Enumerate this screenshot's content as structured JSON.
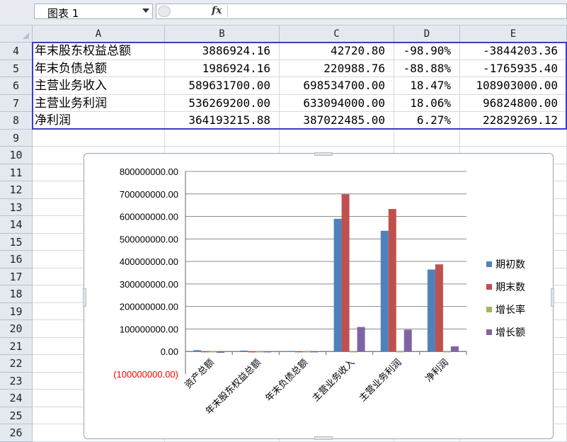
{
  "formula_bar": {
    "name_box": "图表 1",
    "fx_label": "fx",
    "formula": ""
  },
  "columns": [
    "A",
    "B",
    "C",
    "D",
    "E"
  ],
  "row_numbers": [
    "4",
    "5",
    "6",
    "7",
    "8",
    "9",
    "10",
    "11",
    "12",
    "13",
    "14",
    "15",
    "16",
    "17",
    "18",
    "19",
    "20",
    "21",
    "22",
    "23",
    "24",
    "25",
    "26"
  ],
  "rows": [
    [
      "年末股东权益总额",
      "3886924.16",
      "42720.80",
      "-98.90%",
      "-3844203.36"
    ],
    [
      "年末负债总额",
      "1986924.16",
      "220988.76",
      "-88.88%",
      "-1765935.40"
    ],
    [
      "主营业务收入",
      "589631700.00",
      "698534700.00",
      "18.47%",
      "108903000.00"
    ],
    [
      "主营业务利润",
      "536269200.00",
      "633094000.00",
      "18.06%",
      "96824800.00"
    ],
    [
      "净利润",
      "364193215.88",
      "387022485.00",
      "6.27%",
      "22829269.12"
    ]
  ],
  "chart_data": {
    "type": "bar",
    "title": "",
    "categories": [
      "资产总额",
      "年末股东权益总额",
      "年末负债总额",
      "主营业务收入",
      "主营业务利润",
      "净利润"
    ],
    "series": [
      {
        "name": "期初数",
        "color": "#4f81bd",
        "values": [
          5873848.32,
          3886924.16,
          1986924.16,
          589631700.0,
          536269200.0,
          364193215.88
        ]
      },
      {
        "name": "期末数",
        "color": "#c0504d",
        "values": [
          263709.56,
          42720.8,
          220988.76,
          698534700.0,
          633094000.0,
          387022485.0
        ]
      },
      {
        "name": "增长率",
        "color": "#9bbb59",
        "values": [
          -0.96,
          -0.989,
          -0.8888,
          0.1847,
          0.1806,
          0.0627
        ]
      },
      {
        "name": "增长额",
        "color": "#8064a2",
        "values": [
          -5610138.76,
          -3844203.36,
          -1765935.4,
          108903000.0,
          96824800.0,
          22829269.12
        ]
      }
    ],
    "y_ticks": [
      -100000000,
      0,
      100000000,
      200000000,
      300000000,
      400000000,
      500000000,
      600000000,
      700000000,
      800000000
    ],
    "y_tick_labels": [
      "(100000000.00)",
      "0.00",
      "100000000.00",
      "200000000.00",
      "300000000.00",
      "400000000.00",
      "500000000.00",
      "600000000.00",
      "700000000.00",
      "800000000.00"
    ],
    "ylim": [
      -100000000,
      800000000
    ],
    "negative_label_color": "#ff0000",
    "grid": true,
    "legend_position": "right"
  }
}
